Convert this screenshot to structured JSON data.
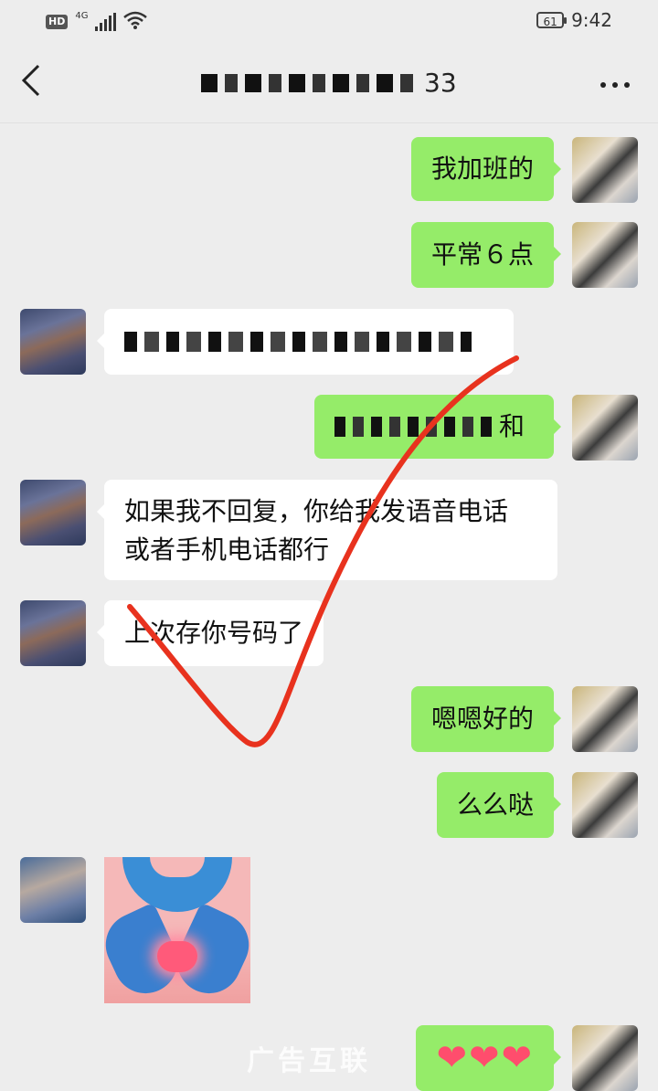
{
  "status": {
    "hd": "HD",
    "network": "4G",
    "battery": "61",
    "time": "9:42"
  },
  "header": {
    "back_icon": "chevron-left-icon",
    "title_suffix": "33",
    "more_icon": "more-dots-icon"
  },
  "messages": [
    {
      "from": "me",
      "text": "我加班的"
    },
    {
      "from": "me",
      "text": "平常６点"
    },
    {
      "from": "other",
      "text": "",
      "note": "pixelated"
    },
    {
      "from": "me",
      "text": "和",
      "note": "pixelated"
    },
    {
      "from": "other",
      "text_line1": "如果我不回复，你给我发语音电话",
      "text_line2": "或者手机电话都行"
    },
    {
      "from": "other",
      "text": "上次存你号码了"
    },
    {
      "from": "me",
      "text": "嗯嗯好的"
    },
    {
      "from": "me",
      "text": "么么哒"
    },
    {
      "from": "other",
      "type": "sticker",
      "sticker_icon": "heart-hands-sticker"
    },
    {
      "from": "me",
      "text": "❤❤❤"
    }
  ],
  "watermark": "广告互联",
  "colors": {
    "bg": "#ededed",
    "me_bubble": "#95ec69",
    "other_bubble": "#ffffff",
    "annotation": "#e8321e"
  }
}
